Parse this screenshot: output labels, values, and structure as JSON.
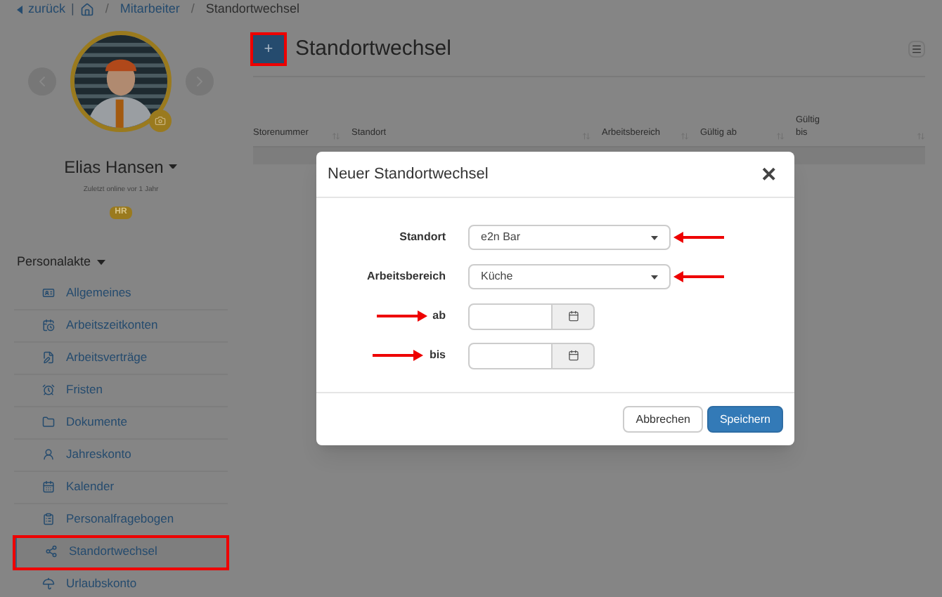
{
  "breadcrumb": {
    "back": "zurück",
    "separator": "|",
    "divider": "/",
    "items": [
      "Mitarbeiter",
      "Standortwechsel"
    ]
  },
  "profile": {
    "name": "Elias Hansen",
    "last_online": "Zuletzt online vor 1 Jahr",
    "badge": "HR"
  },
  "sidebar": {
    "heading": "Personalakte",
    "items": [
      {
        "label": "Allgemeines",
        "selected": false,
        "highlighted": false
      },
      {
        "label": "Arbeitszeitkonten",
        "selected": false,
        "highlighted": false
      },
      {
        "label": "Arbeitsverträge",
        "selected": false,
        "highlighted": false
      },
      {
        "label": "Fristen",
        "selected": false,
        "highlighted": false
      },
      {
        "label": "Dokumente",
        "selected": false,
        "highlighted": false
      },
      {
        "label": "Jahreskonto",
        "selected": false,
        "highlighted": false
      },
      {
        "label": "Kalender",
        "selected": false,
        "highlighted": false
      },
      {
        "label": "Personalfragebogen",
        "selected": false,
        "highlighted": false
      },
      {
        "label": "Standortwechsel",
        "selected": true,
        "highlighted": true
      },
      {
        "label": "Urlaubskonto",
        "selected": false,
        "highlighted": false
      }
    ]
  },
  "main": {
    "title": "Standortwechsel",
    "add_button": {
      "label": "+",
      "highlighted": true
    },
    "table": {
      "columns": [
        "Storenummer",
        "Standort",
        "Arbeitsbereich",
        "Gültig ab",
        "Gültig bis"
      ]
    }
  },
  "dialog": {
    "title": "Neuer Standortwechsel",
    "close": "✕",
    "fields": [
      {
        "kind": "select",
        "label": "Standort",
        "value": "e2n Bar",
        "marked": true
      },
      {
        "kind": "select",
        "label": "Arbeitsbereich",
        "value": "Küche",
        "marked": true
      },
      {
        "kind": "date",
        "label": "ab",
        "marked": true
      },
      {
        "kind": "date",
        "label": "bis",
        "marked": true
      }
    ],
    "buttons": [
      {
        "label": "Abbrechen",
        "kind": "secondary"
      },
      {
        "label": "Speichern",
        "kind": "primary"
      }
    ]
  }
}
